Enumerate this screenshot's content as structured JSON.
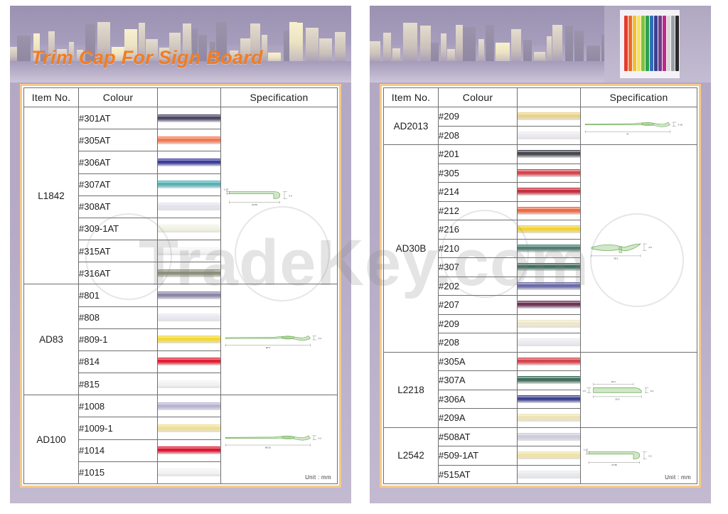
{
  "banner": {
    "title": "Trim Cap For Sign Board",
    "photo_name": "city-skyline-photo",
    "spool_photo_name": "trim-cap-rolls-photo"
  },
  "watermark": {
    "text": "TradeKey.com"
  },
  "table_headers": {
    "item": "Item No.",
    "colour": "Colour",
    "specification": "Specification"
  },
  "unit_note": "Unit : mm",
  "left_panel": {
    "groups": [
      {
        "item_no": "L1842",
        "colours": [
          {
            "code": "#301AT",
            "swatch": "#4a4663"
          },
          {
            "code": "#305AT",
            "swatch": "#f4764f"
          },
          {
            "code": "#306AT",
            "swatch": "#3a3d9b"
          },
          {
            "code": "#307AT",
            "swatch": "#54b2b6"
          },
          {
            "code": "#308AT",
            "swatch": "#e6e3ee"
          },
          {
            "code": "#309-1AT",
            "swatch": "#f2f2e2"
          },
          {
            "code": "#315AT",
            "swatch": "#f4f4f4"
          },
          {
            "code": "#316AT",
            "swatch": "#8d8f78"
          }
        ],
        "spec": {
          "shape": "j-hook",
          "dims": {
            "thickness": "1.25",
            "width": "20.35",
            "height": "4.3"
          }
        }
      },
      {
        "item_no": "AD83",
        "colours": [
          {
            "code": "#801",
            "swatch": "#8b85a8"
          },
          {
            "code": "#808",
            "swatch": "#e9e7f0"
          },
          {
            "code": "#809-1",
            "swatch": "#f2d938"
          },
          {
            "code": "#814",
            "swatch": "#e01f33"
          },
          {
            "code": "#815",
            "swatch": "#f3f1f4"
          }
        ],
        "spec": {
          "shape": "flat-blade",
          "dims": {
            "width": "60.5",
            "height": "4.2"
          }
        }
      },
      {
        "item_no": "AD100",
        "colours": [
          {
            "code": "#1008",
            "swatch": "#b9b3d2"
          },
          {
            "code": "#1009-1",
            "swatch": "#efdf94"
          },
          {
            "code": "#1014",
            "swatch": "#dc1730"
          },
          {
            "code": "#1015",
            "swatch": "#f4f2f4"
          }
        ],
        "spec": {
          "shape": "flat-blade",
          "dims": {
            "width": "88.25",
            "height": "4.2"
          }
        }
      }
    ]
  },
  "right_panel": {
    "groups": [
      {
        "item_no": "AD2013",
        "colours": [
          {
            "code": "#209",
            "swatch": "#e8d38a"
          },
          {
            "code": "#208",
            "swatch": "#eceaf0"
          }
        ],
        "spec": {
          "shape": "flat-blade",
          "dims": {
            "width": "37",
            "height": "4.18"
          }
        }
      },
      {
        "item_no": "AD30B",
        "colours": [
          {
            "code": "#201",
            "swatch": "#45464e"
          },
          {
            "code": "#305",
            "swatch": "#d6434a"
          },
          {
            "code": "#214",
            "swatch": "#c62f3f"
          },
          {
            "code": "#212",
            "swatch": "#ee6a43"
          },
          {
            "code": "#216",
            "swatch": "#f2d235"
          },
          {
            "code": "#210",
            "swatch": "#4f7d72"
          },
          {
            "code": "#307",
            "swatch": "#3f6e5c"
          },
          {
            "code": "#202",
            "swatch": "#6b6aa8"
          },
          {
            "code": "#207",
            "swatch": "#6e3356"
          },
          {
            "code": "#209",
            "swatch": "#efe7cc"
          },
          {
            "code": "#208",
            "swatch": "#eceaf0"
          }
        ],
        "spec": {
          "shape": "mushroom-cap",
          "dims": {
            "width": "28.1",
            "height": "4.6"
          }
        }
      },
      {
        "item_no": "L2218",
        "colours": [
          {
            "code": "#305A",
            "swatch": "#d6434a"
          },
          {
            "code": "#307A",
            "swatch": "#3f6e5c"
          },
          {
            "code": "#306A",
            "swatch": "#3f4390"
          },
          {
            "code": "#209A",
            "swatch": "#eee3b6"
          }
        ],
        "spec": {
          "shape": "angled-cap",
          "dims": {
            "thickness": "1.5",
            "inner_width": "18.3",
            "outer_width": "20.5",
            "height": "5.2"
          }
        }
      },
      {
        "item_no": "L2542",
        "colours": [
          {
            "code": "#508AT",
            "swatch": "#ceccdc"
          },
          {
            "code": "#509-1AT",
            "swatch": "#efe3a4"
          },
          {
            "code": "#515AT",
            "swatch": "#e9eaee"
          }
        ],
        "spec": {
          "shape": "j-hook",
          "dims": {
            "thickness": "1.25",
            "width": "27.86",
            "height": "4.2"
          }
        }
      }
    ]
  },
  "colors": {
    "title_orange": "#f07d22",
    "frame_border": "#f6c98a",
    "drawing_green": "#6aa84f",
    "page_purple": "#b3a8c4"
  }
}
